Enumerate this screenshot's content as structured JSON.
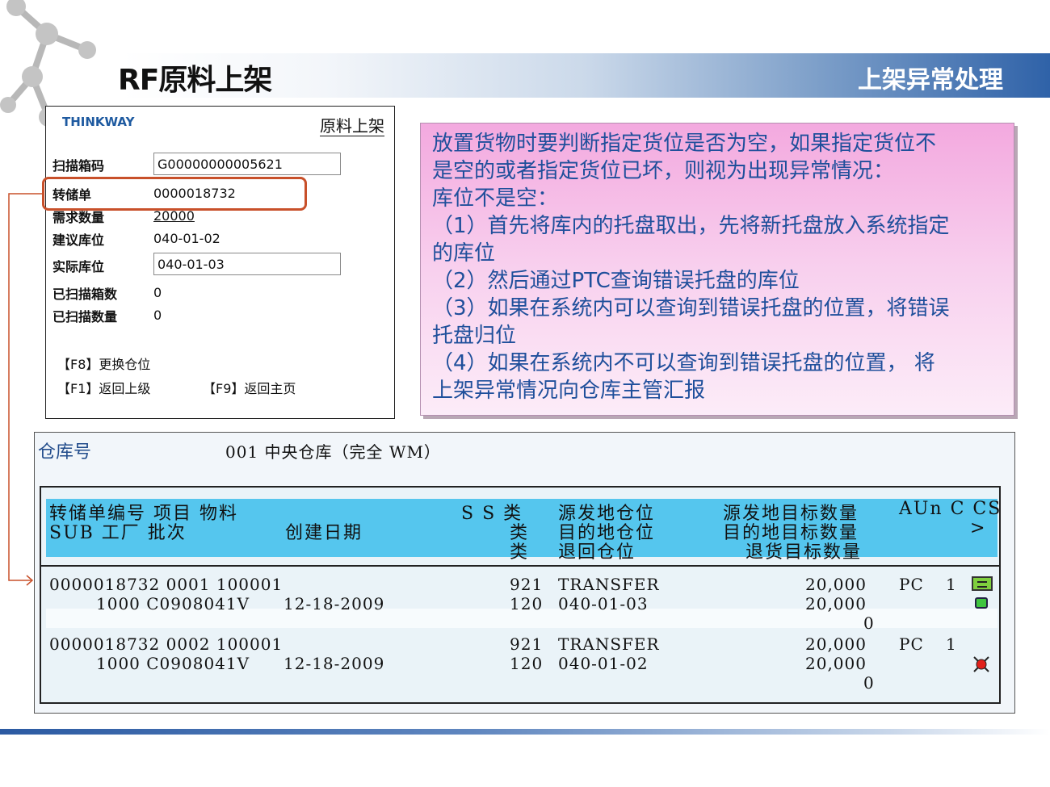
{
  "slide": {
    "title": "RF原料上架",
    "section": "上架异常处理"
  },
  "rf": {
    "brand": "THINKWAY",
    "screen_title": "原料上架",
    "fields": [
      {
        "label": "扫描箱码",
        "value": "G00000000005621"
      },
      {
        "label": "转储单",
        "value": "0000018732"
      },
      {
        "label": "需求数量",
        "value": "20000"
      },
      {
        "label": "建议库位",
        "value": "040-01-02"
      },
      {
        "label": "实际库位",
        "value": "040-01-03"
      },
      {
        "label": "已扫描箱数",
        "value": "0"
      },
      {
        "label": "已扫描数量",
        "value": "0"
      }
    ],
    "f8": "【F8】更换仓位",
    "f1": "【F1】返回上级",
    "f9": "【F9】返回主页"
  },
  "note": {
    "lines": [
      "放置货物时要判断指定货位是否为空，如果指定货位不",
      "是空的或者指定货位已坏，则视为出现异常情况：",
      "库位不是空：",
      "（1）首先将库内的托盘取出，先将新托盘放入系统指定",
      "的库位",
      "（2）然后通过PTC查询错误托盘的库位",
      "（3）如果在系统内可以查询到错误托盘的位置，将错误",
      "托盘归位",
      "（4）如果在系统内不可以查询到错误托盘的位置， 将",
      "上架异常情况向仓库主管汇报"
    ]
  },
  "sap": {
    "warehouse_label": "仓库号",
    "warehouse_value": "001  中央仓库（完全 WM）",
    "header": {
      "row1": {
        "a": "转储单编号 项目 物料",
        "b": "S S 类",
        "c": "源发地仓位",
        "d": "源发地目标数量",
        "e": "AUn C CS"
      },
      "row2": {
        "a": "SUB 工厂 批次",
        "a2": "创建日期",
        "b": "类",
        "c": "目的地仓位",
        "d": "目的地目标数量",
        "e": ">"
      },
      "row3": {
        "b": "类",
        "c": "退回仓位",
        "d": "退货目标数量"
      }
    },
    "rows": [
      {
        "line1": {
          "doc": "0000018732 0001 100001",
          "type": "921",
          "bin": "TRANSFER",
          "qty": "20,000",
          "unit": "PC",
          "c": "1"
        },
        "line2": {
          "sub": "1000 C0908041V",
          "date": "12-18-2009",
          "type": "120",
          "bin": "040-01-03",
          "qty": "20,000"
        },
        "line3": {
          "qty": "0"
        },
        "status": "green"
      },
      {
        "line1": {
          "doc": "0000018732 0002 100001",
          "type": "921",
          "bin": "TRANSFER",
          "qty": "20,000",
          "unit": "PC",
          "c": "1"
        },
        "line2": {
          "sub": "1000 C0908041V",
          "date": "12-18-2009",
          "type": "120",
          "bin": "040-01-02",
          "qty": "20,000"
        },
        "line3": {
          "qty": "0"
        },
        "status": "red"
      }
    ]
  },
  "colors": {
    "accent_red": "#c8502a",
    "header_blue": "#2f62a8",
    "note_text": "#1f4f9b",
    "table_header": "#55c6ee"
  }
}
